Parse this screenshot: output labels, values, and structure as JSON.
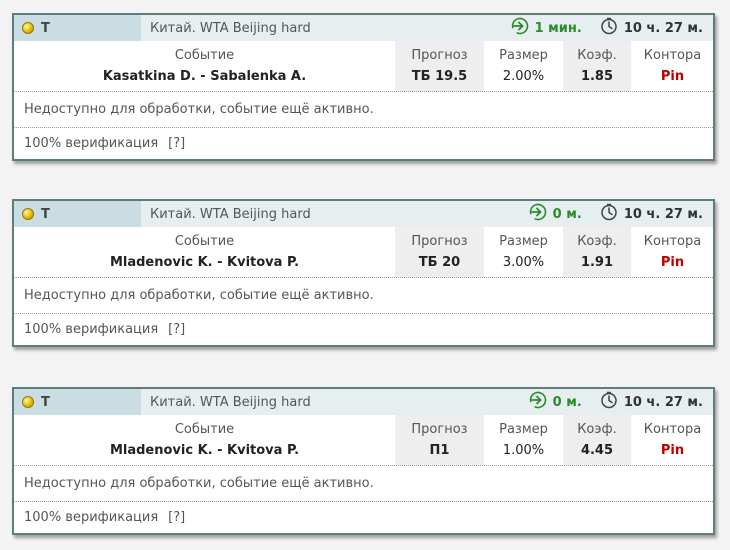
{
  "cards": [
    {
      "sport": "Т",
      "league": "Китай. WTA Beijing hard",
      "status": "1 мин.",
      "timer": "10 ч. 27 м.",
      "event_label": "Событие",
      "event": "Kasatkina D. - Sabalenka A.",
      "pred_label": "Прогноз",
      "pred": "ТБ 19.5",
      "size_label": "Размер",
      "size": "2.00%",
      "odds_label": "Коэф.",
      "odds": "1.85",
      "book_label": "Контора",
      "book": "Pin",
      "note": "Недоступно для обработки, событие ещё активно.",
      "verify": "100% верификация",
      "help": "[?]"
    },
    {
      "sport": "Т",
      "league": "Китай. WTA Beijing hard",
      "status": "0 м.",
      "timer": "10 ч. 27 м.",
      "event_label": "Событие",
      "event": "Mladenovic K. - Kvitova P.",
      "pred_label": "Прогноз",
      "pred": "ТБ 20",
      "size_label": "Размер",
      "size": "3.00%",
      "odds_label": "Коэф.",
      "odds": "1.91",
      "book_label": "Контора",
      "book": "Pin",
      "note": "Недоступно для обработки, событие ещё активно.",
      "verify": "100% верификация",
      "help": "[?]"
    },
    {
      "sport": "Т",
      "league": "Китай. WTA Beijing hard",
      "status": "0 м.",
      "timer": "10 ч. 27 м.",
      "event_label": "Событие",
      "event": "Mladenovic K. - Kvitova P.",
      "pred_label": "Прогноз",
      "pred": "П1",
      "size_label": "Размер",
      "size": "1.00%",
      "odds_label": "Коэф.",
      "odds": "4.45",
      "book_label": "Контора",
      "book": "Pin",
      "note": "Недоступно для обработки, событие ещё активно.",
      "verify": "100% верификация",
      "help": "[?]"
    }
  ],
  "colors": {
    "status_green": "#2c8a2c",
    "book_red": "#c00000",
    "border": "#5e7d7d"
  },
  "icons": {
    "sport": "tennis-ball-icon",
    "status": "arrow-in-circle-icon",
    "timer": "stopwatch-icon"
  }
}
